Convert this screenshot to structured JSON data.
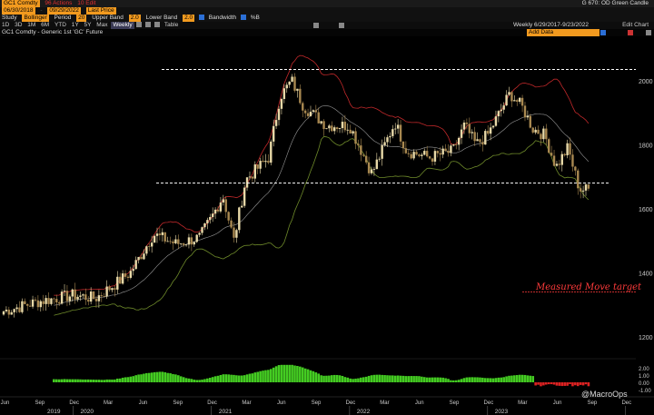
{
  "header": {
    "security_code": "GC1 Comdty",
    "menu_actions": "96 Actions",
    "menu_edit": "10 Edit",
    "title": "G 670: OD Green Candle",
    "date_from": "06/30/2018",
    "date_to": "09/29/2022",
    "period_type": "Last Price",
    "study_label": "Study",
    "study_value": "Bollinger",
    "period_label": "Period",
    "period_value": "20",
    "upper_band_label": "Upper Band",
    "upper_band_value": "2.0",
    "lower_band_label": "Lower Band",
    "lower_band_value": "2.0",
    "bandwidth_label": "Bandwidth",
    "pct_b_label": "%B",
    "range_buttons": [
      "1D",
      "3D",
      "1M",
      "6M",
      "YTD",
      "1Y",
      "5Y",
      "Max"
    ],
    "period_select": "Weekly",
    "table_label": "Table",
    "security_desc": "GC1 Comdty - Generic 1st 'GC' Future",
    "add_data": "Add Data",
    "range_text": "Weekly  6/29/2017-9/23/2022",
    "edit_chart": "Edit Chart"
  },
  "colors": {
    "up": "#e8d9a8",
    "down": "#a88850",
    "upper_band": "#c0282a",
    "lower_band": "#6e8a2a",
    "middle_band": "#9a9a9a",
    "hist_pos": "#44cc22",
    "hist_neg": "#dd2222",
    "annotation": "#ff3b3b",
    "dashed": "#ffffff"
  },
  "chart_data": {
    "type": "candlestick",
    "frequency": "weekly",
    "ylim": [
      1160,
      2110
    ],
    "yticks": [
      1200,
      1400,
      1600,
      1800,
      2000
    ],
    "x_month_labels": [
      "Jun",
      "Sep",
      "Dec",
      "Mar",
      "Jun",
      "Sep",
      "Dec",
      "Mar",
      "Jun",
      "Sep",
      "Dec",
      "Mar",
      "Jun",
      "Sep",
      "Dec",
      "Mar",
      "Jun",
      "Sep",
      "Dec"
    ],
    "x_year_labels": [
      "2019",
      "2020",
      "2021",
      "2022",
      "2023"
    ],
    "anchors": [
      {
        "date": "2018-07",
        "close": 1280
      },
      {
        "date": "2018-10",
        "close": 1310
      },
      {
        "date": "2019-01",
        "close": 1330
      },
      {
        "date": "2019-03",
        "close": 1320
      },
      {
        "date": "2019-06",
        "close": 1400
      },
      {
        "date": "2019-08",
        "close": 1520
      },
      {
        "date": "2019-10",
        "close": 1490
      },
      {
        "date": "2019-12",
        "close": 1510
      },
      {
        "date": "2020-01",
        "close": 1570
      },
      {
        "date": "2020-02",
        "close": 1640
      },
      {
        "date": "2020-03",
        "close": 1500
      },
      {
        "date": "2020-04",
        "close": 1690
      },
      {
        "date": "2020-06",
        "close": 1760
      },
      {
        "date": "2020-07",
        "close": 1950
      },
      {
        "date": "2020-08",
        "close": 2000
      },
      {
        "date": "2020-09",
        "close": 1920
      },
      {
        "date": "2020-11",
        "close": 1860
      },
      {
        "date": "2021-01",
        "close": 1860
      },
      {
        "date": "2021-03",
        "close": 1710
      },
      {
        "date": "2021-05",
        "close": 1870
      },
      {
        "date": "2021-06",
        "close": 1780
      },
      {
        "date": "2021-08",
        "close": 1760
      },
      {
        "date": "2021-10",
        "close": 1780
      },
      {
        "date": "2021-11",
        "close": 1860
      },
      {
        "date": "2021-12",
        "close": 1800
      },
      {
        "date": "2022-01",
        "close": 1830
      },
      {
        "date": "2022-03",
        "close": 1960
      },
      {
        "date": "2022-04",
        "close": 1920
      },
      {
        "date": "2022-05",
        "close": 1850
      },
      {
        "date": "2022-06",
        "close": 1830
      },
      {
        "date": "2022-07",
        "close": 1730
      },
      {
        "date": "2022-08",
        "close": 1790
      },
      {
        "date": "2022-09",
        "close": 1660
      }
    ],
    "resistance_level": 2035,
    "support_level": 1680,
    "target_level": 1340,
    "target_label": "Measured Move target",
    "indicator": {
      "name": "Bandwidth",
      "yticks": [
        "2.00",
        "1.00",
        "0.00",
        "-1.00"
      ]
    },
    "watermark": "@MacroOps"
  }
}
